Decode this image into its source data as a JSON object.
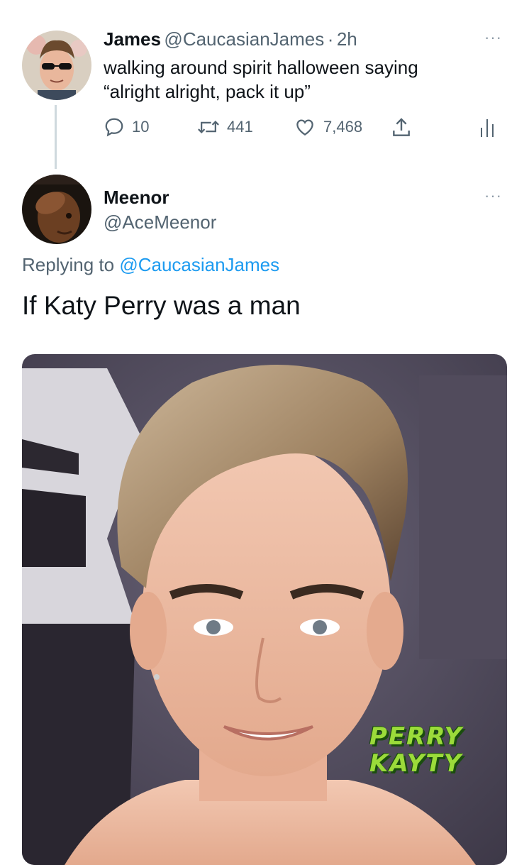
{
  "tweet": {
    "name": "James",
    "handle": "@CaucasianJames",
    "separator": "·",
    "time": "2h",
    "text_line1": "walking around spirit halloween saying",
    "text_line2": "“alright alright, pack it up”",
    "more_label": "···",
    "actions": {
      "replies": "10",
      "retweets": "441",
      "likes": "7,468"
    }
  },
  "reply": {
    "name": "Meenor",
    "handle": "@AceMeenor",
    "more_label": "···",
    "replying_prefix": "Replying to",
    "replying_handle": "@CaucasianJames",
    "text": "If Katy Perry was a man",
    "media_caption_line1": "PERRY",
    "media_caption_line2": "KAYTY"
  },
  "colors": {
    "accent": "#1d9bf0",
    "muted": "#536471",
    "text": "#0f1419",
    "caption_green": "#9bdb3a"
  },
  "icons": [
    "reply-icon",
    "retweet-icon",
    "like-icon",
    "share-icon",
    "analytics-icon",
    "more-icon"
  ]
}
